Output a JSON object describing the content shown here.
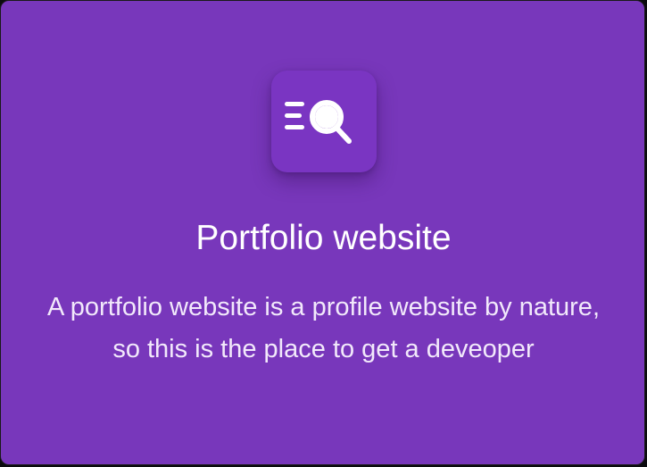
{
  "card": {
    "icon": "search-list-icon",
    "title": "Portfolio website",
    "description": "A portfolio website is a profile website by nature, so this is the place to get a deveoper"
  },
  "colors": {
    "card_background": "#7837bb",
    "icon_tile_background": "#7a35c2",
    "text": "#ffffff"
  }
}
